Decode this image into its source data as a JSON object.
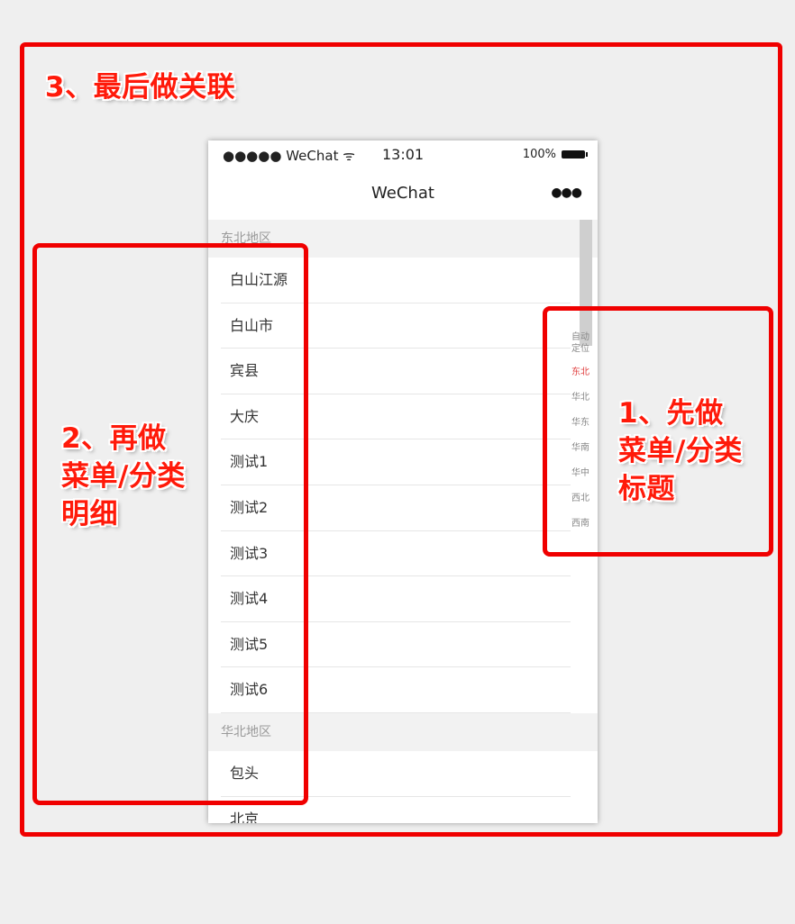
{
  "annotations": {
    "step3": "3、最后做关联",
    "step2": "2、再做\n菜单/分类\n明细",
    "step1": "1、先做\n菜单/分类\n标题"
  },
  "phone": {
    "status": {
      "carrier": "●●●●● WeChat ᯤ",
      "time": "13:01",
      "battery": "100%"
    },
    "nav": {
      "title": "WeChat",
      "more": "●●●"
    },
    "sections": [
      {
        "header": "东北地区",
        "items": [
          "白山江源",
          "白山市",
          "宾县",
          "大庆",
          "测试1",
          "测试2",
          "测试3",
          "测试4",
          "测试5",
          "测试6"
        ]
      },
      {
        "header": "华北地区",
        "items": [
          "包头",
          "北京"
        ]
      }
    ],
    "index": [
      {
        "label": "自动\n定位",
        "active": false
      },
      {
        "label": "东北",
        "active": true
      },
      {
        "label": "华北",
        "active": false
      },
      {
        "label": "华东",
        "active": false
      },
      {
        "label": "华南",
        "active": false
      },
      {
        "label": "华中",
        "active": false
      },
      {
        "label": "西北",
        "active": false
      },
      {
        "label": "西南",
        "active": false
      }
    ]
  },
  "colors": {
    "annotation_red": "#f00000",
    "index_active": "#e04040"
  }
}
